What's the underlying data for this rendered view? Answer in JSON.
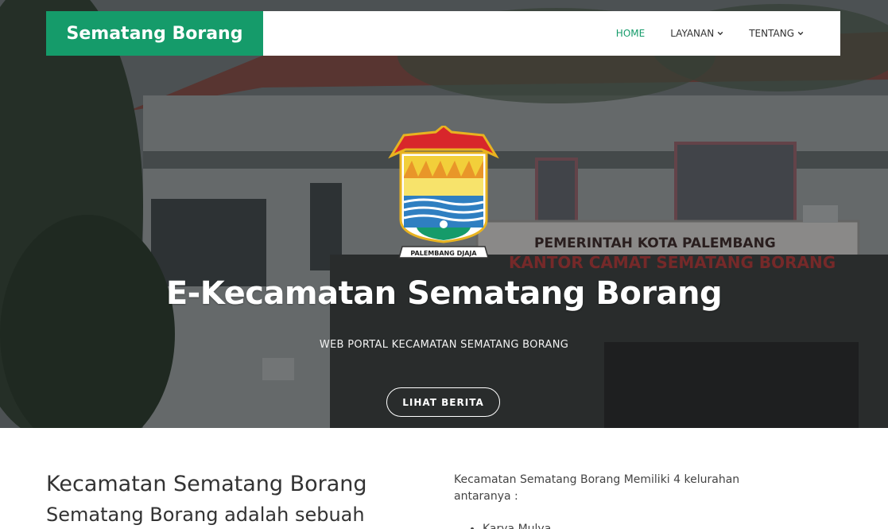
{
  "brand": "Sematang Borang",
  "nav": {
    "home": "HOME",
    "layanan": "LAYANAN",
    "tentang": "TENTANG"
  },
  "hero": {
    "logo_caption": "PALEMBANG DJAJA",
    "sign_line1": "PEMERINTAH KOTA PALEMBANG",
    "sign_line2": "KANTOR CAMAT SEMATANG BORANG",
    "title": "E-Kecamatan Sematang Borang",
    "subtitle": "WEB PORTAL KECAMATAN SEMATANG BORANG",
    "button": "LIHAT BERITA"
  },
  "content": {
    "heading": "Kecamatan Sematang Borang",
    "subheading": "Sematang Borang adalah sebuah",
    "intro": "Kecamatan Sematang Borang Memiliki 4 kelurahan antaranya :",
    "kelurahan": [
      "Karya Mulya"
    ]
  },
  "colors": {
    "brand_green": "#159b6a",
    "nav_text": "#333333"
  }
}
